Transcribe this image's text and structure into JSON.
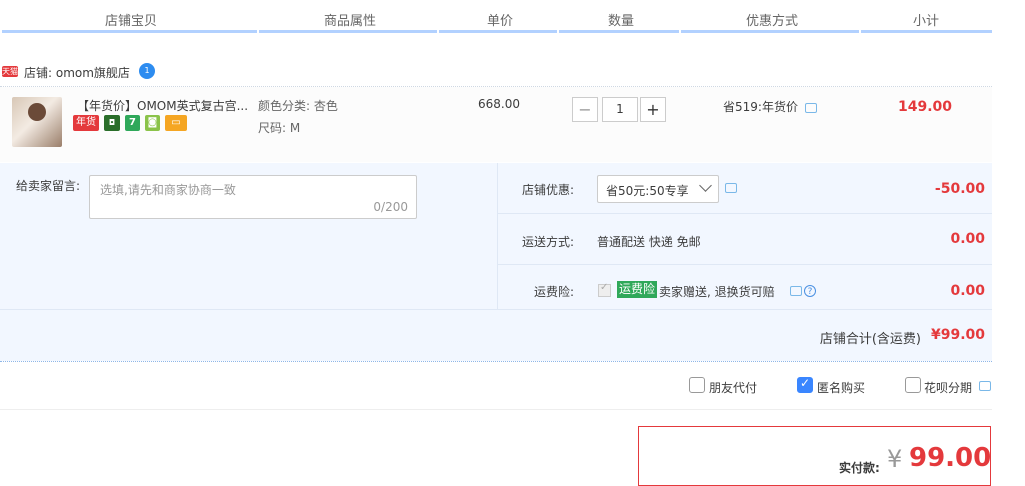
{
  "header": {
    "columns": [
      "店铺宝贝",
      "商品属性",
      "单价",
      "数量",
      "优惠方式",
      "小计"
    ]
  },
  "shop": {
    "badge": "天猫",
    "name": "店铺: omom旗舰店"
  },
  "item": {
    "title": "【年货价】OMOM英式复古宫...",
    "tags": [
      "年货",
      "7"
    ],
    "attr_color": "颜色分类: 杏色",
    "attr_size": "尺码: M",
    "unit_price": "668.00",
    "qty_minus": "−",
    "qty_value": "1",
    "qty_plus": "+",
    "promo": "省519:年货价",
    "subtotal": "149.00"
  },
  "message": {
    "label": "给卖家留言:",
    "placeholder": "选填,请先和商家协商一致",
    "counter": "0/200"
  },
  "options": {
    "shop_discount_label": "店铺优惠:",
    "shop_discount_select": "省50元:50专享",
    "shop_discount_value": "-50.00",
    "shipping_label": "运送方式:",
    "shipping_desc": "普通配送 快递 免邮",
    "shipping_value": "0.00",
    "insurance_label": "运费险:",
    "insurance_badge": "运费险",
    "insurance_desc": "卖家赠送, 退换货可赔",
    "insurance_value": "0.00",
    "help": "?"
  },
  "shop_total": {
    "label": "店铺合计(含运费)",
    "value": "¥99.00"
  },
  "payment_options": {
    "friend_pay": "朋友代付",
    "anonymous": "匿名购买",
    "huabei": "花呗分期"
  },
  "total": {
    "label": "实付款:",
    "currency": "¥",
    "amount": "99.00"
  },
  "colors": {
    "price_red": "#e4393c",
    "header_line": "#b2d1ff",
    "panel_bg": "#f2f7ff",
    "checkbox_blue": "#3a86ff",
    "insurance_green": "#2fa85a"
  }
}
